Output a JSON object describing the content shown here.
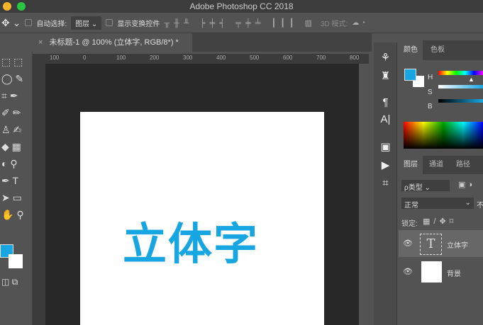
{
  "window": {
    "title": "Adobe Photoshop CC 2018"
  },
  "options": {
    "auto_select": "自动选择:",
    "layer_select": "图层",
    "show_transform": "显示变换控件",
    "mode_3d": "3D 模式:"
  },
  "document": {
    "tab_title": "未标题-1 @ 100% (立体字, RGB/8*) *",
    "close": "×",
    "text": "立体字",
    "text_color": "#18a6e2"
  },
  "ruler": {
    "ticks": [
      "100",
      "0",
      "100",
      "200",
      "300",
      "400",
      "500",
      "600",
      "700",
      "800"
    ]
  },
  "color_panel": {
    "tabs": [
      "颜色",
      "色板"
    ],
    "labels": [
      "H",
      "S",
      "B"
    ],
    "foreground": "#18a6e2",
    "background": "#ffffff"
  },
  "layers_panel": {
    "tabs": [
      "图层",
      "通道",
      "路径"
    ],
    "filter": "ρ类型",
    "blend_mode": "正常",
    "opacity_label": "不",
    "lock_label": "锁定:",
    "layers": [
      {
        "name": "立体字",
        "type": "text"
      },
      {
        "name": "背景",
        "type": "fill"
      }
    ]
  }
}
